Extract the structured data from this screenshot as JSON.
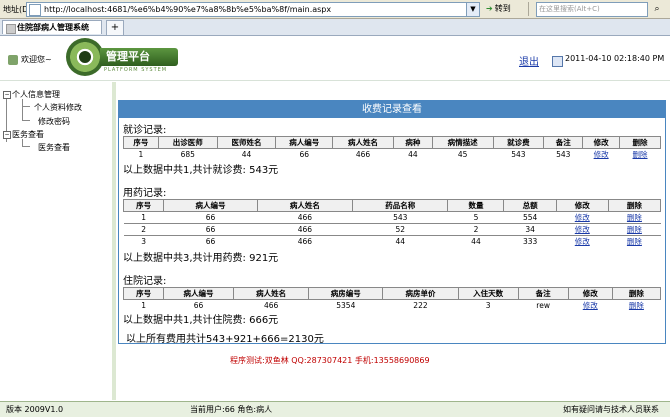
{
  "address_bar": {
    "label": "地址(D)",
    "url": "http://localhost:4681/%e6%b4%90%e7%a8%8b%e5%ba%8f/main.aspx",
    "go_label": "转到",
    "search_placeholder": "在这里搜索(Alt+C)"
  },
  "tab": {
    "title": "住院部病人管理系统"
  },
  "header": {
    "welcome": "欢迎您~",
    "brand": "管理平台",
    "brand_sub": "PLATFORM SYSTEM",
    "logout": "退出",
    "datetime": "2011-04-10 02:18:40 PM"
  },
  "nav": {
    "items": [
      {
        "label": "个人信息管理"
      },
      {
        "label": "个人资料修改"
      },
      {
        "label": "修改密码"
      },
      {
        "label": "医务查看"
      },
      {
        "label": "医务查看"
      }
    ]
  },
  "panel": {
    "title": "收费记录查看",
    "visit": {
      "label": "就诊记录:",
      "headers": [
        "序号",
        "出诊医师",
        "医师姓名",
        "病人编号",
        "病人姓名",
        "病种",
        "病情描述",
        "就诊费",
        "备注",
        "修改",
        "删除"
      ],
      "rows": [
        [
          "1",
          "685",
          "44",
          "66",
          "466",
          "44",
          "45",
          "543",
          "543",
          "修改",
          "删除"
        ]
      ],
      "summary": "以上数据中共1,共计就诊费: 543元"
    },
    "medicine": {
      "label": "用药记录:",
      "headers": [
        "序号",
        "病人编号",
        "病人姓名",
        "药品名称",
        "数量",
        "总额",
        "修改",
        "删除"
      ],
      "rows": [
        [
          "1",
          "66",
          "466",
          "543",
          "5",
          "554",
          "修改",
          "删除"
        ],
        [
          "2",
          "66",
          "466",
          "52",
          "2",
          "34",
          "修改",
          "删除"
        ],
        [
          "3",
          "66",
          "466",
          "44",
          "44",
          "333",
          "修改",
          "删除"
        ]
      ],
      "summary": "以上数据中共3,共计用药费: 921元"
    },
    "hospital": {
      "label": "住院记录:",
      "headers": [
        "序号",
        "病人编号",
        "病人姓名",
        "病房编号",
        "病房单价",
        "入住天数",
        "备注",
        "修改",
        "删除"
      ],
      "rows": [
        [
          "1",
          "66",
          "466",
          "5354",
          "222",
          "3",
          "rew",
          "修改",
          "删除"
        ]
      ],
      "summary": "以上数据中共1,共计住院费: 666元"
    },
    "total": "以上所有费用共计543+921+666=2130元"
  },
  "contact": "程序测试:双鱼林 QQ:287307421 手机:13558690869",
  "status": {
    "version": "版本 2009V1.0",
    "user": "当前用户:66 角色:病人",
    "help": "如有疑问请与技术人员联系"
  }
}
